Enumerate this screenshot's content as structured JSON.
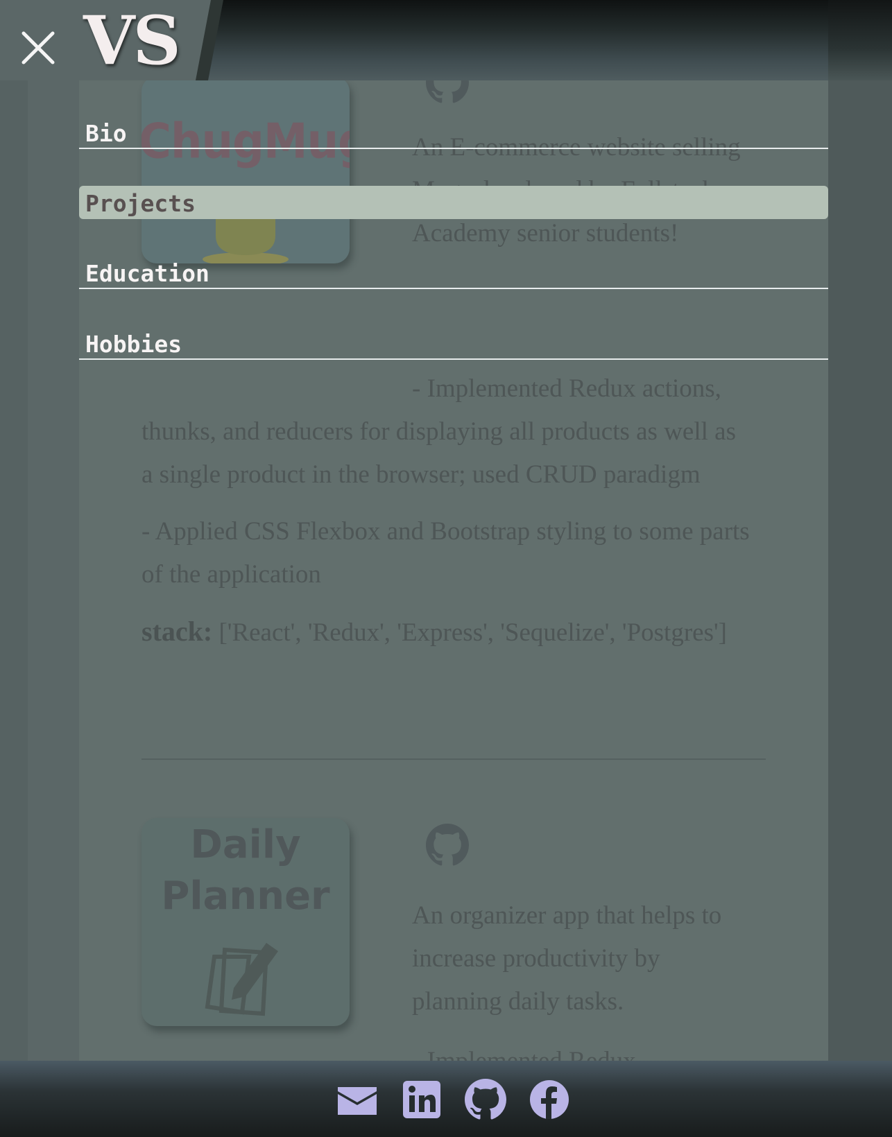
{
  "header": {
    "logo_text": "VS",
    "close_icon": "close-icon"
  },
  "nav": {
    "items": [
      {
        "label": "Bio"
      },
      {
        "label": "Projects",
        "active": true
      },
      {
        "label": "Education"
      },
      {
        "label": "Hobbies"
      }
    ]
  },
  "projects": [
    {
      "thumb_title": "ChugMugs",
      "repo_icon": "github-icon",
      "description": "An E-commerce website selling Mugs developed by Fullstack Academy senior students!",
      "bullets": [
        "- Implemented Redux actions, thunks, and reducers for displaying all products as well as a single product in the browser; used CRUD paradigm",
        "- Applied CSS Flexbox and Bootstrap styling to some parts of the application"
      ],
      "stack_label": "stack:",
      "stack_value": "['React', 'Redux', 'Express', 'Sequelize', 'Postgres']"
    },
    {
      "thumb_title_line1": "Daily",
      "thumb_title_line2": "Planner",
      "repo_icon": "github-icon",
      "description": "An organizer app that helps to increase productivity by planning daily tasks.",
      "bullets": [
        "- Implemented Redux"
      ]
    }
  ],
  "footer": {
    "icons": [
      "mail-icon",
      "linkedin-icon",
      "github-icon",
      "facebook-icon"
    ]
  },
  "colors": {
    "icon_accent": "#b9b4e6",
    "nav_active_bg": "#b4c1b6",
    "content_bg": "#626f6d"
  }
}
